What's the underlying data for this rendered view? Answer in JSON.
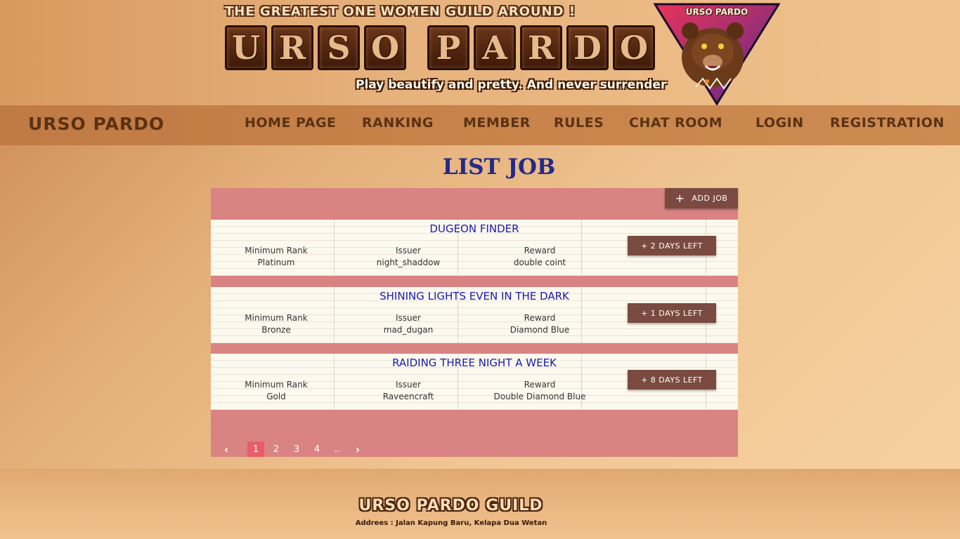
{
  "header": {
    "tagline": "THE GREATEST ONE WOMEN GUILD AROUND !",
    "logo_letters": [
      "U",
      "R",
      "S",
      "O",
      "",
      "P",
      "A",
      "R",
      "D",
      "O"
    ],
    "subtagline": "Play beautify and pretty.  And never surrender",
    "emblem_text": "URSO PARDO"
  },
  "nav": {
    "brand": "URSO PARDO",
    "items": [
      "HOME PAGE",
      "RANKING",
      "MEMBER",
      "RULES",
      "CHAT ROOM",
      "LOGIN",
      "REGISTRATION"
    ]
  },
  "page": {
    "title": "LIST JOB",
    "add_job_label": "ADD JOB"
  },
  "jobs": [
    {
      "title": "DUGEON FINDER",
      "rank_label": "Minimum Rank",
      "rank": "Platinum",
      "issuer_label": "Issuer",
      "issuer": "night_shaddow",
      "reward_label": "Reward",
      "reward": "double coint",
      "days": "+ 2 DAYS LEFT"
    },
    {
      "title": "SHINING LIGHTS EVEN IN THE DARK",
      "rank_label": "Minimum Rank",
      "rank": "Bronze",
      "issuer_label": "Issuer",
      "issuer": "mad_dugan",
      "reward_label": "Reward",
      "reward": "Diamond Blue",
      "days": "+ 1 DAYS LEFT"
    },
    {
      "title": "RAIDING THREE NIGHT A WEEK",
      "rank_label": "Minimum Rank",
      "rank": "Gold",
      "issuer_label": "Issuer",
      "issuer": "Raveencraft",
      "reward_label": "Reward",
      "reward": "Double Diamond Blue",
      "days": "+ 8 DAYS LEFT"
    }
  ],
  "pagination": {
    "prev": "‹",
    "pages": [
      "1",
      "2",
      "3",
      "4",
      ".."
    ],
    "active": "1",
    "next": "›"
  },
  "footer": {
    "title": "URSO PARDO GUILD",
    "address": "Addrees : Jalan Kapung Baru, Kelapa Dua Wetan"
  },
  "colors": {
    "nav_bg": "#c07a44",
    "panel_bg": "#d98383",
    "button_bg": "#7a4a40",
    "title_color": "#232a8a",
    "job_title_color": "#1a1ab8",
    "active_page": "#e85d6a"
  }
}
